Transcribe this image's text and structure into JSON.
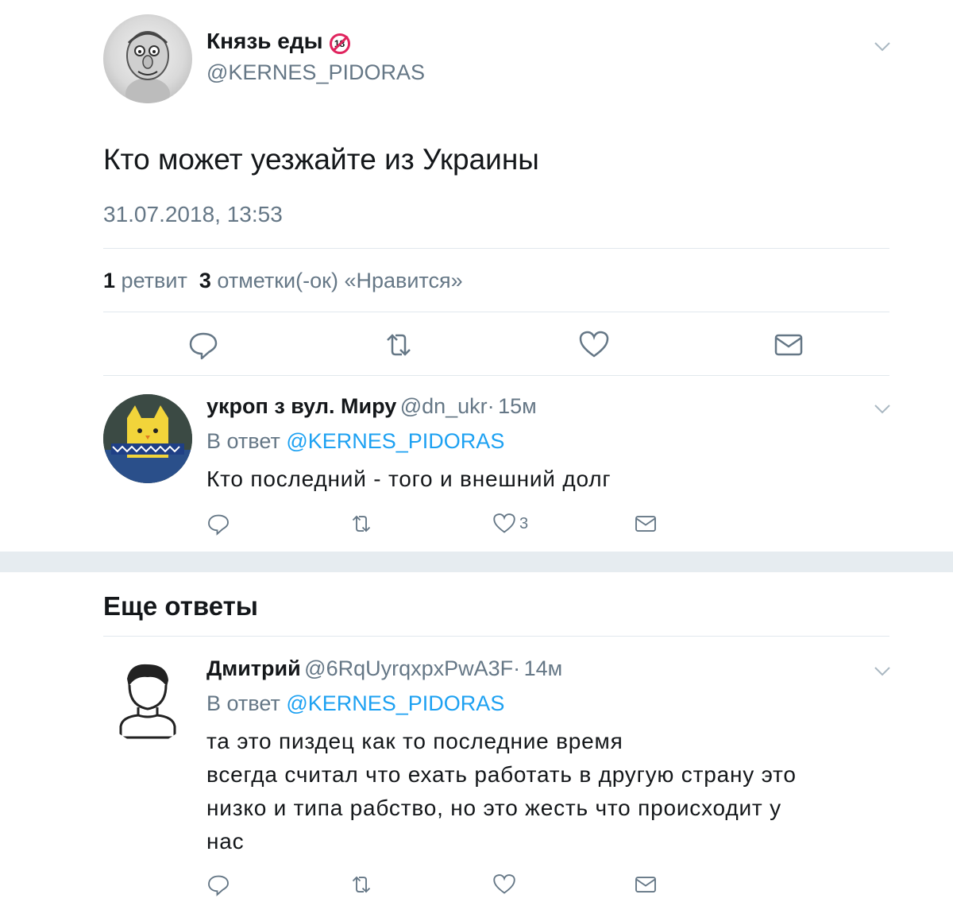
{
  "tweet": {
    "author_name": "Князь еды",
    "badge": "18",
    "author_handle": "@KERNES_PIDORAS",
    "text": "Кто может уезжайте из Украины",
    "timestamp": "31.07.2018, 13:53",
    "retweet_count": "1",
    "retweet_label": "ретвит",
    "like_count": "3",
    "like_label": "отметки(-ок) «Нравится»"
  },
  "replies": [
    {
      "name": "укроп з вул. Миру",
      "handle": "@dn_ukr",
      "separator": "·",
      "time": "15м",
      "in_reply_prefix": "В ответ",
      "in_reply_handle": "@KERNES_PIDORAS",
      "text": "Кто последний - того и внешний долг",
      "likes": "3"
    }
  ],
  "more_replies_title": "Еще ответы",
  "more_replies": [
    {
      "name": "Дмитрий",
      "handle": "@6RqUyrqxpxPwA3F",
      "separator": "·",
      "time": "14м",
      "in_reply_prefix": "В ответ",
      "in_reply_handle": "@KERNES_PIDORAS",
      "text_lines": [
        "та это пиздец как то последние время",
        "всегда считал что ехать работать в другую страну это",
        "низко и типа рабство, но это жесть что происходит у",
        "нас"
      ]
    }
  ],
  "icons": [
    "reply-icon",
    "retweet-icon",
    "like-icon",
    "dm-icon",
    "chevron-down-icon"
  ],
  "colors": {
    "link": "#1da1f2",
    "secondary_text": "#657786",
    "divider": "#e1e8ed",
    "band": "#e6ecf0"
  }
}
